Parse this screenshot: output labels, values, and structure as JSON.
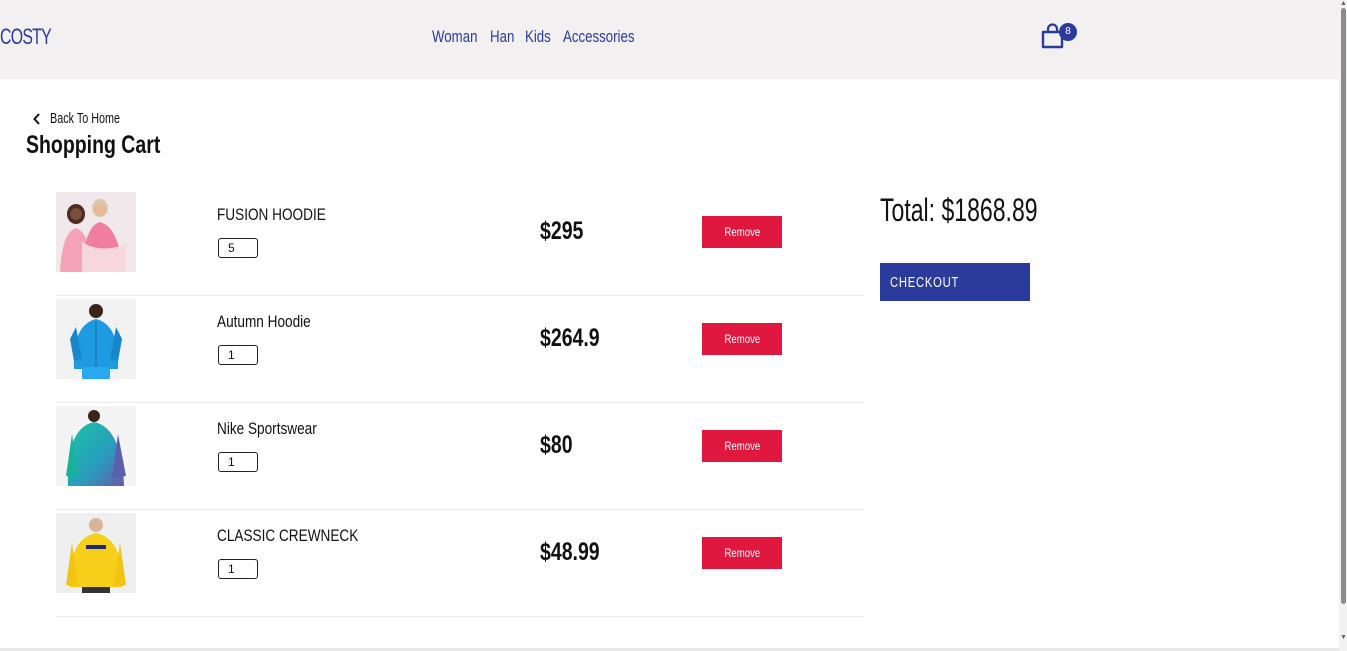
{
  "header": {
    "logo": "COSTY",
    "nav": [
      "Woman",
      "Han",
      "Kids",
      "Accessories"
    ],
    "cart_count": "8"
  },
  "back_label": "Back To Home",
  "page_title": "Shopping Cart",
  "items": [
    {
      "name": "FUSION HOODIE",
      "qty": "5",
      "price": "$295",
      "remove_label": "Remove",
      "image": "pink-hoodie-photo"
    },
    {
      "name": "Autumn Hoodie",
      "qty": "1",
      "price": "$264.9",
      "remove_label": "Remove",
      "image": "blue-puffer-jacket-photo"
    },
    {
      "name": "Nike Sportswear",
      "qty": "1",
      "price": "$80",
      "remove_label": "Remove",
      "image": "teal-sweatshirt-photo"
    },
    {
      "name": "CLASSIC CREWNECK",
      "qty": "1",
      "price": "$48.99",
      "remove_label": "Remove",
      "image": "yellow-crewneck-photo"
    }
  ],
  "summary": {
    "total": "Total: $1868.89",
    "checkout_label": "CHECKOUT"
  },
  "colors": {
    "brand": "#2a3b9c",
    "remove": "#e0173f",
    "header_bg": "#f2f0f1"
  }
}
